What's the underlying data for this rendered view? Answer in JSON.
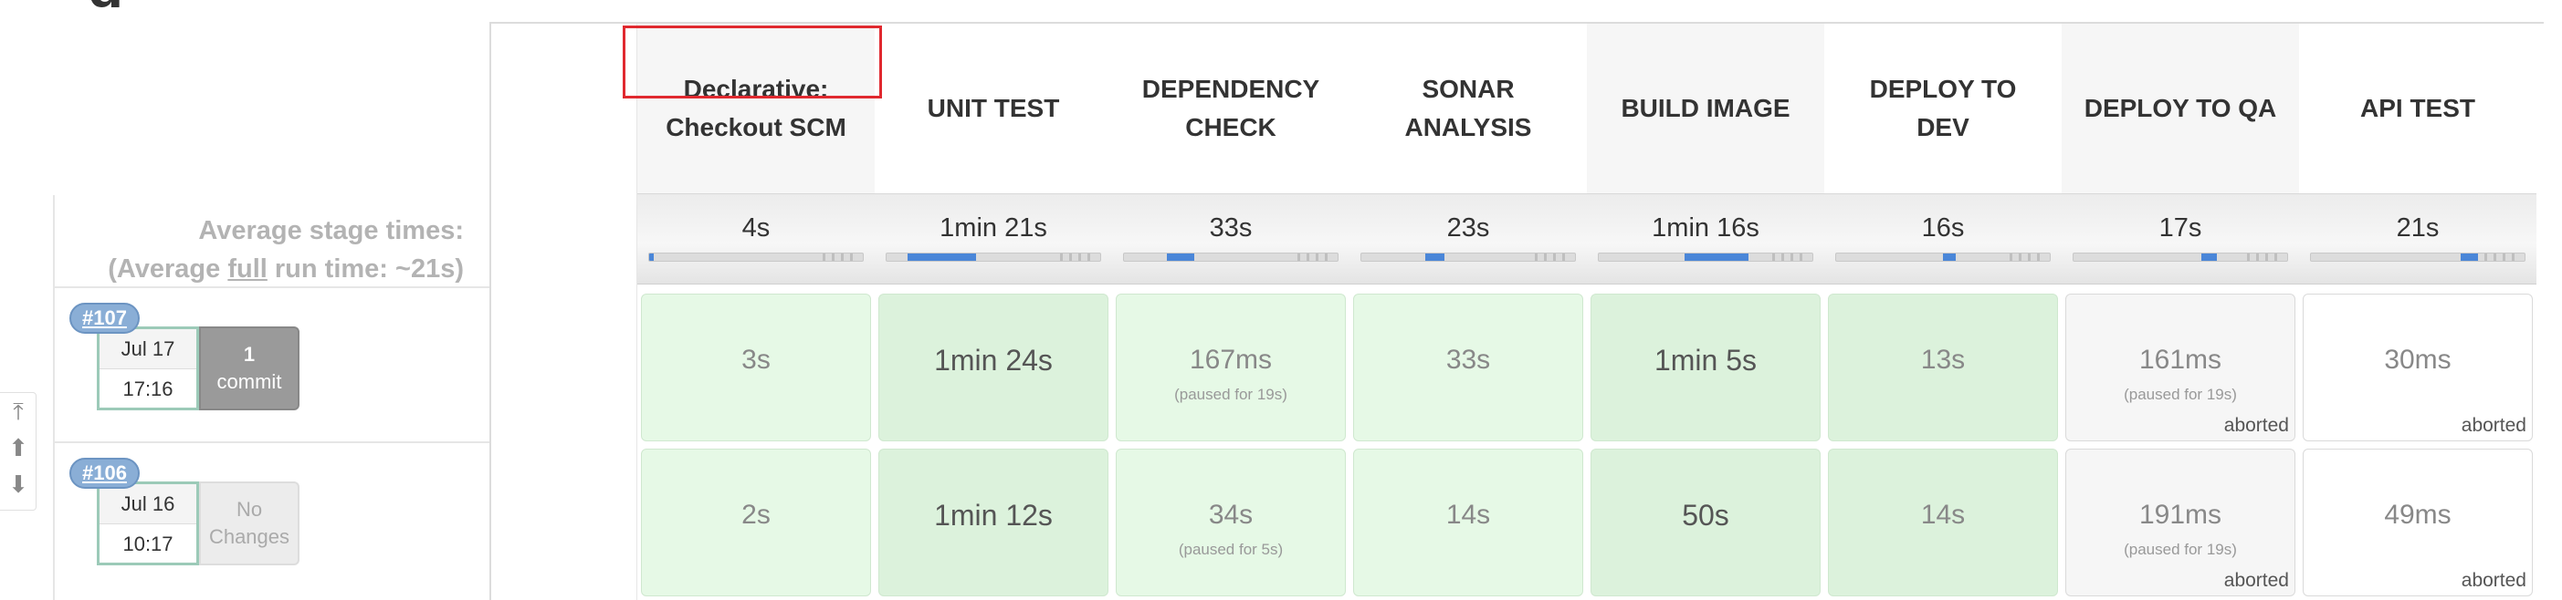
{
  "page": {
    "heading_fragment": "g"
  },
  "summary": {
    "avg_stage_times_label": "Average stage times:",
    "avg_full_prefix": "(Average ",
    "avg_full_word": "full",
    "avg_full_suffix": " run time: ~21s)"
  },
  "stages": [
    {
      "name": "Declarative: Checkout SCM",
      "avg": "4s",
      "bar_fraction": 0.02
    },
    {
      "name": "UNIT TEST",
      "avg": "1min 21s",
      "bar_fraction": 0.32
    },
    {
      "name": "DEPENDENCY CHECK",
      "avg": "33s",
      "bar_fraction": 0.13
    },
    {
      "name": "SONAR ANALYSIS",
      "avg": "23s",
      "bar_fraction": 0.09
    },
    {
      "name": "BUILD IMAGE",
      "avg": "1min 16s",
      "bar_fraction": 0.3
    },
    {
      "name": "DEPLOY TO DEV",
      "avg": "16s",
      "bar_fraction": 0.06
    },
    {
      "name": "DEPLOY TO QA",
      "avg": "17s",
      "bar_fraction": 0.07
    },
    {
      "name": "API TEST",
      "avg": "21s",
      "bar_fraction": 0.08
    }
  ],
  "runs": [
    {
      "build": "#107",
      "date": "Jul 17",
      "time": "17:16",
      "changes_count": "1",
      "changes_label": "commit",
      "cells": [
        {
          "duration": "3s",
          "pause": "",
          "status": ""
        },
        {
          "duration": "1min 24s",
          "pause": "",
          "status": ""
        },
        {
          "duration": "167ms",
          "pause": "(paused for 19s)",
          "status": ""
        },
        {
          "duration": "33s",
          "pause": "",
          "status": ""
        },
        {
          "duration": "1min 5s",
          "pause": "",
          "status": ""
        },
        {
          "duration": "13s",
          "pause": "",
          "status": ""
        },
        {
          "duration": "161ms",
          "pause": "(paused for 19s)",
          "status": "aborted"
        },
        {
          "duration": "30ms",
          "pause": "",
          "status": "aborted"
        }
      ]
    },
    {
      "build": "#106",
      "date": "Jul 16",
      "time": "10:17",
      "changes_line1": "No",
      "changes_line2": "Changes",
      "cells": [
        {
          "duration": "2s",
          "pause": "",
          "status": ""
        },
        {
          "duration": "1min 12s",
          "pause": "",
          "status": ""
        },
        {
          "duration": "34s",
          "pause": "(paused for 5s)",
          "status": ""
        },
        {
          "duration": "14s",
          "pause": "",
          "status": ""
        },
        {
          "duration": "50s",
          "pause": "",
          "status": ""
        },
        {
          "duration": "14s",
          "pause": "",
          "status": ""
        },
        {
          "duration": "191ms",
          "pause": "(paused for 19s)",
          "status": "aborted"
        },
        {
          "duration": "49ms",
          "pause": "",
          "status": "aborted"
        }
      ]
    }
  ],
  "colors": {
    "success": "#e6f9e6",
    "aborted": "#f6f6f6",
    "progress": "#4a86d8",
    "highlight": "#e0292f",
    "badge": "#8aaed6"
  },
  "icons": {
    "scroll_top": "arrow-to-top-icon",
    "scroll_up": "arrow-up-icon",
    "scroll_down": "arrow-down-icon"
  }
}
